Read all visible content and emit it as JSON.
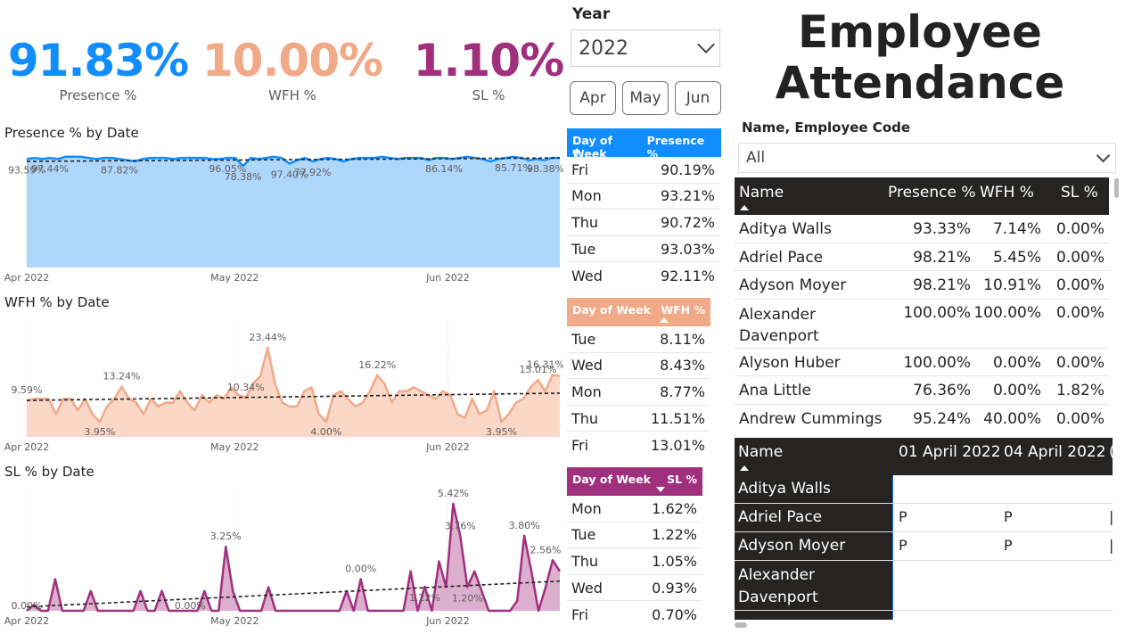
{
  "kpis": [
    {
      "value": "91.83%",
      "label": "Presence %",
      "color": "#118DFF"
    },
    {
      "value": "10.00%",
      "label": "WFH %",
      "color": "#F2A987"
    },
    {
      "value": "1.10%",
      "label": "SL %",
      "color": "#A0307E"
    }
  ],
  "year_slicer": {
    "title": "Year",
    "value": "2022"
  },
  "months": [
    "Apr",
    "May",
    "Jun"
  ],
  "title": {
    "line1": "Employee",
    "line2": "Attendance"
  },
  "name_slicer": {
    "title": "Name, Employee Code",
    "value": "All"
  },
  "chart_data": [
    {
      "type": "area",
      "title": "Presence % by Date",
      "x_ticks": [
        "Apr 2022",
        "May 2022",
        "Jun 2022"
      ],
      "color": "#118DFF",
      "fill": "#A6D3FC",
      "ylim": [
        0,
        100
      ],
      "values": [
        95,
        96,
        95,
        96,
        95,
        97,
        97,
        97,
        96,
        95,
        96,
        96,
        95,
        94,
        93,
        95,
        96,
        96,
        96,
        95,
        96,
        96,
        96,
        96,
        95,
        95,
        96,
        96,
        89,
        96,
        95,
        96,
        97,
        96,
        91,
        94,
        96,
        93,
        95,
        96,
        95,
        93,
        95,
        96,
        96,
        96,
        97,
        96,
        95,
        96,
        96,
        96,
        94,
        96,
        96,
        95,
        96,
        97,
        96,
        95,
        93,
        95,
        96,
        97,
        96,
        94,
        95,
        94,
        96,
        96
      ],
      "labels": [
        {
          "text": "93.59%",
          "i": 0
        },
        {
          "text": "97.44%",
          "i": 3
        },
        {
          "text": "87.82%",
          "i": 12
        },
        {
          "text": "96.05%",
          "i": 26
        },
        {
          "text": "78.38%",
          "i": 28
        },
        {
          "text": "97.40%",
          "i": 34
        },
        {
          "text": "77.92%",
          "i": 37
        },
        {
          "text": "86.14%",
          "i": 54
        },
        {
          "text": "85.71%",
          "i": 63
        },
        {
          "text": "98.38%",
          "i": 68
        }
      ],
      "trend": [
        93,
        96
      ]
    },
    {
      "type": "area",
      "title": "WFH % by Date",
      "x_ticks": [
        "Apr 2022",
        "May 2022",
        "Jun 2022"
      ],
      "color": "#F2A987",
      "fill": "#F9D3C1",
      "ylim": [
        0,
        30
      ],
      "values": [
        9.59,
        10,
        10,
        10,
        6,
        10,
        10,
        7,
        10,
        6,
        3.95,
        8,
        10,
        13.24,
        10,
        9,
        6,
        10,
        8,
        9,
        9,
        12,
        9,
        7,
        11,
        9,
        11,
        10,
        13,
        11,
        10.34,
        14,
        16,
        23.44,
        14,
        9,
        8,
        8,
        12,
        13,
        6,
        4,
        11,
        12,
        10,
        8,
        9,
        12,
        16.22,
        14,
        9,
        12,
        12,
        13,
        12,
        11,
        10,
        12,
        11,
        6,
        5,
        10,
        6,
        7,
        12,
        3.95,
        6,
        9,
        10,
        13,
        15.01,
        12,
        16.31,
        16
      ],
      "labels": [
        {
          "text": "9.59%",
          "i": 0
        },
        {
          "text": "3.95%",
          "i": 10
        },
        {
          "text": "13.24%",
          "i": 13
        },
        {
          "text": "10.34%",
          "i": 30
        },
        {
          "text": "23.44%",
          "i": 33
        },
        {
          "text": "4.00%",
          "i": 41
        },
        {
          "text": "16.22%",
          "i": 48
        },
        {
          "text": "3.95%",
          "i": 65
        },
        {
          "text": "15.01%",
          "i": 70
        },
        {
          "text": "16.31%",
          "i": 72
        }
      ],
      "trend": [
        9.6,
        11.5
      ]
    },
    {
      "type": "area",
      "title": "SL % by Date",
      "x_ticks": [
        "Apr 2022",
        "May 2022",
        "Jun 2022"
      ],
      "color": "#A0307E",
      "fill": "#D9A6C9",
      "ylim": [
        0,
        6
      ],
      "values": [
        0,
        0.3,
        0,
        0,
        1.6,
        0,
        0,
        0,
        0,
        1,
        0,
        0,
        0,
        0,
        0,
        0,
        1,
        0,
        0,
        1,
        0,
        0,
        0,
        0,
        0,
        1,
        0,
        0,
        3.25,
        1,
        0,
        0,
        0,
        0,
        1.2,
        0,
        0,
        0,
        0,
        0,
        0,
        0,
        0,
        0,
        0,
        1,
        0,
        1.6,
        0,
        0,
        0,
        0,
        0,
        0,
        2,
        0,
        1.22,
        0,
        2.5,
        1.2,
        5.42,
        3.76,
        1.2,
        2,
        1,
        0,
        0,
        0,
        0,
        0.5,
        3.8,
        2,
        0,
        1.2,
        2.56,
        2
      ],
      "labels": [
        {
          "text": "0.00%",
          "i": 0
        },
        {
          "text": "3.25%",
          "i": 28
        },
        {
          "text": "0.00%",
          "i": 23
        },
        {
          "text": "0.00%",
          "i": 47
        },
        {
          "text": "1.22%",
          "i": 56
        },
        {
          "text": "5.42%",
          "i": 60
        },
        {
          "text": "3.76%",
          "i": 61
        },
        {
          "text": "1.20%",
          "i": 62
        },
        {
          "text": "3.80%",
          "i": 70
        },
        {
          "text": "2.56%",
          "i": 74
        }
      ],
      "trend": [
        0.2,
        1.5
      ]
    },
    {
      "type": "table",
      "headers": [
        "Day of Week",
        "Presence %"
      ],
      "header_color": "#118DFF",
      "rows": [
        [
          "Fri",
          "90.19%"
        ],
        [
          "Mon",
          "93.21%"
        ],
        [
          "Thu",
          "90.72%"
        ],
        [
          "Tue",
          "93.03%"
        ],
        [
          "Wed",
          "92.11%"
        ]
      ]
    },
    {
      "type": "table",
      "headers": [
        "Day of Week",
        "WFH %"
      ],
      "header_color": "#F2A987",
      "rows": [
        [
          "Tue",
          "8.11%"
        ],
        [
          "Wed",
          "8.43%"
        ],
        [
          "Mon",
          "8.77%"
        ],
        [
          "Thu",
          "11.51%"
        ],
        [
          "Fri",
          "13.01%"
        ]
      ]
    },
    {
      "type": "table",
      "headers": [
        "Day of Week",
        "SL %"
      ],
      "header_color": "#A0307E",
      "rows": [
        [
          "Mon",
          "1.62%"
        ],
        [
          "Tue",
          "1.22%"
        ],
        [
          "Thu",
          "1.05%"
        ],
        [
          "Wed",
          "0.93%"
        ],
        [
          "Fri",
          "0.70%"
        ]
      ]
    },
    {
      "type": "table",
      "headers": [
        "Name",
        "Presence %",
        "WFH %",
        "SL %"
      ],
      "rows": [
        [
          "Aditya Walls",
          "93.33%",
          "7.14%",
          "0.00%"
        ],
        [
          "Adriel Pace",
          "98.21%",
          "5.45%",
          "0.00%"
        ],
        [
          "Adyson Moyer",
          "98.21%",
          "10.91%",
          "0.00%"
        ],
        [
          "Alexander Davenport",
          "100.00%",
          "100.00%",
          "0.00%"
        ],
        [
          "Alyson Huber",
          "100.00%",
          "0.00%",
          "0.00%"
        ],
        [
          "Ana Little",
          "76.36%",
          "0.00%",
          "1.82%"
        ],
        [
          "Andrew Cummings",
          "95.24%",
          "40.00%",
          "0.00%"
        ]
      ]
    },
    {
      "type": "table",
      "headers": [
        "Name",
        "01 April 2022",
        "04 April 2022"
      ],
      "rows": [
        [
          "Aditya Walls",
          "",
          ""
        ],
        [
          "Adriel Pace",
          "P",
          "P"
        ],
        [
          "Adyson Moyer",
          "P",
          "P"
        ],
        [
          "Alexander Davenport",
          "",
          ""
        ]
      ]
    }
  ]
}
